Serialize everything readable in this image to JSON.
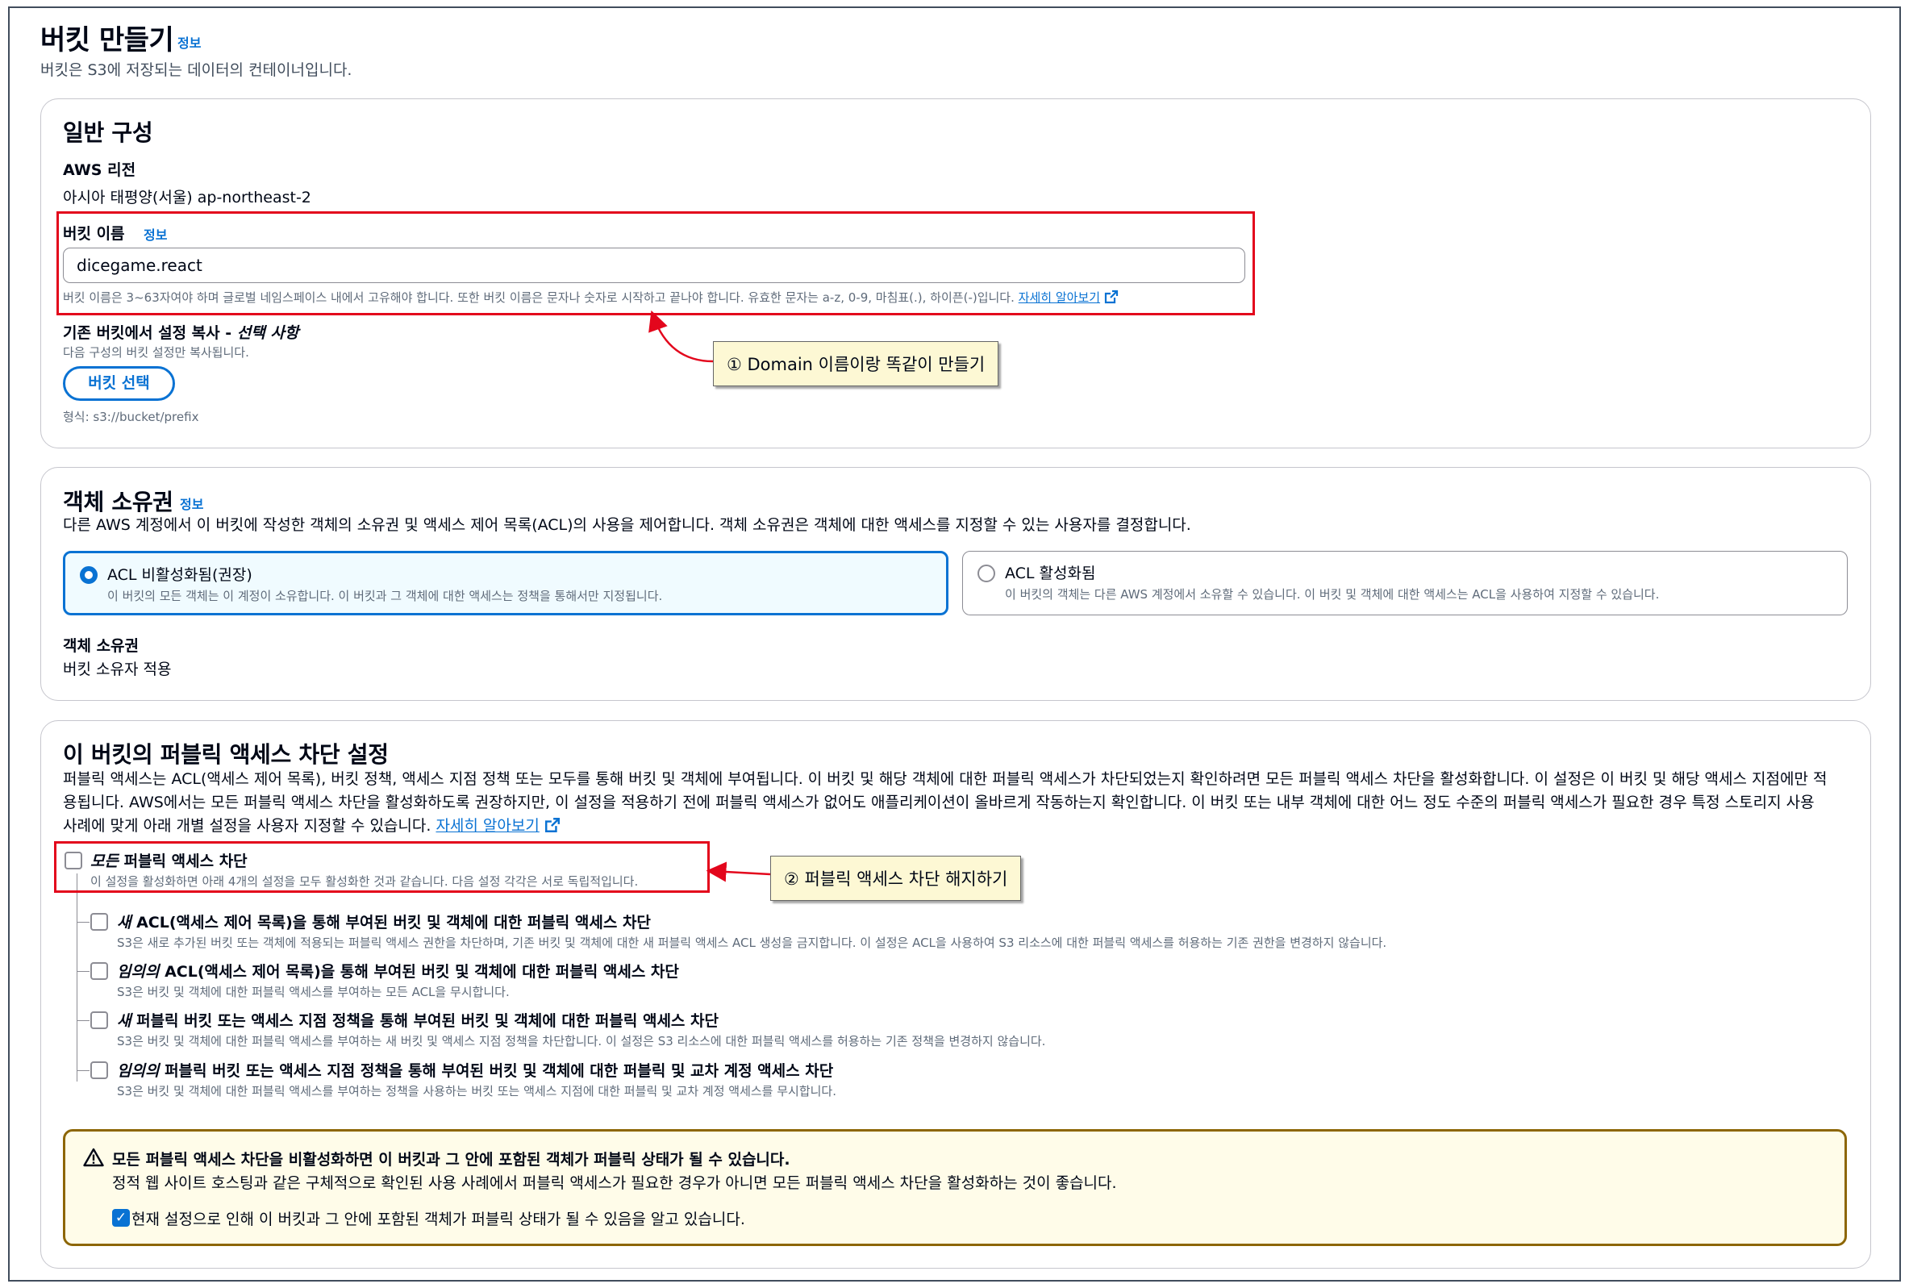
{
  "page": {
    "title": "버킷 만들기",
    "info_link": "정보",
    "description": "버킷은 S3에 저장되는 데이터의 컨테이너입니다."
  },
  "general": {
    "heading": "일반 구성",
    "region_label": "AWS 리전",
    "region_value": "아시아 태평양(서울) ap-northeast-2",
    "bucket_name_label": "버킷 이름",
    "bucket_name_info": "정보",
    "bucket_name_value": "dicegame.react",
    "bucket_name_hint": "버킷 이름은 3~63자여야 하며 글로벌 네임스페이스 내에서 고유해야 합니다. 또한 버킷 이름은 문자나 숫자로 시작하고 끝나야 합니다. 유효한 문자는 a-z, 0-9, 마침표(.), 하이픈(-)입니다.",
    "learn_more": "자세히 알아보기",
    "copy_label_main": "기존 버킷에서 설정 복사 - ",
    "copy_label_optional": "선택 사항",
    "copy_desc": "다음 구성의 버킷 설정만 복사됩니다.",
    "choose_bucket_button": "버킷 선택",
    "format_hint": "형식: s3://bucket/prefix"
  },
  "ownership": {
    "heading": "객체 소유권",
    "info_link": "정보",
    "description": "다른 AWS 계정에서 이 버킷에 작성한 객체의 소유권 및 액세스 제어 목록(ACL)의 사용을 제어합니다. 객체 소유권은 객체에 대한 액세스를 지정할 수 있는 사용자를 결정합니다.",
    "options": [
      {
        "label": "ACL 비활성화됨(권장)",
        "desc": "이 버킷의 모든 객체는 이 계정이 소유합니다. 이 버킷과 그 객체에 대한 액세스는 정책을 통해서만 지정됩니다.",
        "selected": true
      },
      {
        "label": "ACL 활성화됨",
        "desc": "이 버킷의 객체는 다른 AWS 계정에서 소유할 수 있습니다. 이 버킷 및 객체에 대한 액세스는 ACL을 사용하여 지정할 수 있습니다.",
        "selected": false
      }
    ],
    "result_label": "객체 소유권",
    "result_value": "버킷 소유자 적용"
  },
  "public_access": {
    "heading": "이 버킷의 퍼블릭 액세스 차단 설정",
    "description_lines": [
      "퍼블릭 액세스는 ACL(액세스 제어 목록), 버킷 정책, 액세스 지점 정책 또는 모두를 통해 버킷 및 객체에 부여됩니다. 이 버킷 및 해당 객체에 대한 퍼블릭 액세스가 차단되었는지 확인하려면 모든 퍼블릭 액세스 차단을 활성화합니다. 이 설정은 이 버킷 및 해당 액세스 지점에만 적",
      "용됩니다. AWS에서는 모든 퍼블릭 액세스 차단을 활성화하도록 권장하지만, 이 설정을 적용하기 전에 퍼블릭 액세스가 없어도 애플리케이션이 올바르게 작동하는지 확인합니다. 이 버킷 또는 내부 객체에 대한 어느 정도 수준의 퍼블릭 액세스가 필요한 경우 특정 스토리지 사용",
      "사례에 맞게 아래 개별 설정을 사용자 지정할 수 있습니다."
    ],
    "learn_more": "자세히 알아보기",
    "block_all": {
      "label_em": "모든",
      "label_rest": " 퍼블릭 액세스 차단",
      "desc": "이 설정을 활성화하면 아래 4개의 설정을 모두 활성화한 것과 같습니다. 다음 설정 각각은 서로 독립적입니다.",
      "checked": false
    },
    "sub_options": [
      {
        "em": "새",
        "rest": " ACL(액세스 제어 목록)을 통해 부여된 버킷 및 객체에 대한 퍼블릭 액세스 차단",
        "desc": "S3은 새로 추가된 버킷 또는 객체에 적용되는 퍼블릭 액세스 권한을 차단하며, 기존 버킷 및 객체에 대한 새 퍼블릭 액세스 ACL 생성을 금지합니다. 이 설정은 ACL을 사용하여 S3 리소스에 대한 퍼블릭 액세스를 허용하는 기존 권한을 변경하지 않습니다.",
        "checked": false
      },
      {
        "em": "임의의",
        "rest": " ACL(액세스 제어 목록)을 통해 부여된 버킷 및 객체에 대한 퍼블릭 액세스 차단",
        "desc": "S3은 버킷 및 객체에 대한 퍼블릭 액세스를 부여하는 모든 ACL을 무시합니다.",
        "checked": false
      },
      {
        "em": "새",
        "rest": " 퍼블릭 버킷 또는 액세스 지점 정책을 통해 부여된 버킷 및 객체에 대한 퍼블릭 액세스 차단",
        "desc": "S3은 버킷 및 객체에 대한 퍼블릭 액세스를 부여하는 새 버킷 및 액세스 지점 정책을 차단합니다. 이 설정은 S3 리소스에 대한 퍼블릭 액세스를 허용하는 기존 정책을 변경하지 않습니다.",
        "checked": false
      },
      {
        "em": "임의의",
        "rest": " 퍼블릭 버킷 또는 액세스 지점 정책을 통해 부여된 버킷 및 객체에 대한 퍼블릭 및 교차 계정 액세스 차단",
        "desc": "S3은 버킷 및 객체에 대한 퍼블릭 액세스를 부여하는 정책을 사용하는 버킷 또는 액세스 지점에 대한 퍼블릭 및 교차 계정 액세스를 무시합니다.",
        "checked": false
      }
    ],
    "warning": {
      "title": "모든 퍼블릭 액세스 차단을 비활성화하면 이 버킷과 그 안에 포함된 객체가 퍼블릭 상태가 될 수 있습니다.",
      "text": "정적 웹 사이트 호스팅과 같은 구체적으로 확인된 사용 사례에서 퍼블릭 액세스가 필요한 경우가 아니면 모든 퍼블릭 액세스 차단을 활성화하는 것이 좋습니다.",
      "ack_label": "현재 설정으로 인해 이 버킷과 그 안에 포함된 객체가 퍼블릭 상태가 될 수 있음을 알고 있습니다.",
      "ack_checked": true
    }
  },
  "annotations": {
    "callout1": "① Domain 이름이랑 똑같이 만들기",
    "callout2": "② 퍼블릭 액세스 차단 해지하기"
  },
  "colors": {
    "accent": "#0972d3",
    "annotation_red": "#e3061c",
    "callout_bg": "#fdf8d4",
    "warning_border": "#8d6605"
  }
}
